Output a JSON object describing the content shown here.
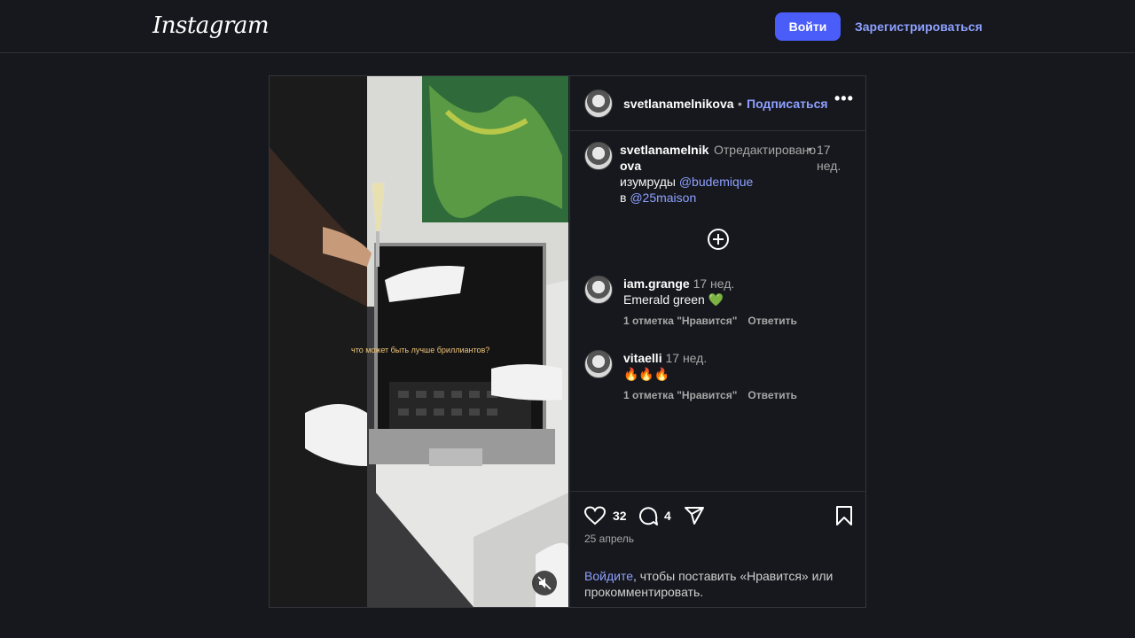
{
  "header": {
    "logo": "Instagram",
    "login_label": "Войти",
    "signup_label": "Зарегистрироваться"
  },
  "post": {
    "author": "svetlanamelnikova",
    "follow_label": "Подписаться",
    "separator": "•",
    "more_label": "•••",
    "caption": {
      "author": "svetlanamelnikova",
      "edited": "Отредактировано",
      "time": "17 нед.",
      "text_before": "изумруды ",
      "mention1": "@budemique",
      "text_mid": "в ",
      "mention2": "@25maison"
    },
    "video_subtitle": "что может быть лучше бриллиантов?",
    "comments": [
      {
        "user": "iam.grange",
        "time": "17 нед.",
        "text": "Emerald green 💚",
        "likes": "1 отметка \"Нравится\"",
        "reply": "Ответить"
      },
      {
        "user": "vitaelli",
        "time": "17 нед.",
        "text": "🔥🔥🔥",
        "likes": "1 отметка \"Нравится\"",
        "reply": "Ответить"
      }
    ],
    "like_count": "32",
    "comment_count": "4",
    "date": "25 апрель",
    "login_prompt_link": "Войдите",
    "login_prompt_text": ", чтобы поставить «Нравится» или прокомментировать."
  }
}
